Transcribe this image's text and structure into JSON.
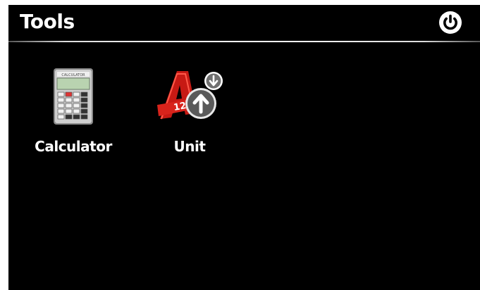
{
  "header": {
    "title": "Tools",
    "power_icon": "power-icon"
  },
  "apps": [
    {
      "label": "Calculator",
      "icon": "calculator-icon",
      "icon_text": "CALCULATOR"
    },
    {
      "label": "Unit",
      "icon": "unit-converter-icon",
      "icon_text": "A 12"
    }
  ],
  "colors": {
    "background": "#000000",
    "text": "#ffffff",
    "accent_red": "#d0201a"
  }
}
